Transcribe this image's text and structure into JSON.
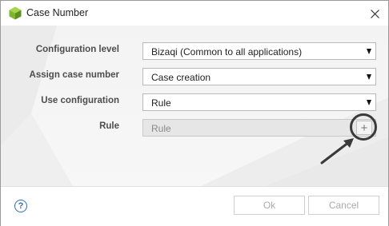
{
  "window": {
    "title": "Case Number",
    "icon": "bizagi-cube-icon",
    "close_icon": "close-icon"
  },
  "form": {
    "configuration_level": {
      "label": "Configuration level",
      "value": "Bizaqi (Common to all applications)"
    },
    "assign_case_number": {
      "label": "Assign case number",
      "value": "Case creation"
    },
    "use_configuration": {
      "label": "Use configuration",
      "value": "Rule"
    },
    "rule": {
      "label": "Rule",
      "value": "Rule",
      "add_symbol": "+"
    }
  },
  "footer": {
    "help_symbol": "?",
    "ok_label": "Ok",
    "cancel_label": "Cancel"
  },
  "colors": {
    "accent_green": "#7db52f",
    "help_blue": "#2e6fb7",
    "annotation": "#3a3a3a"
  }
}
